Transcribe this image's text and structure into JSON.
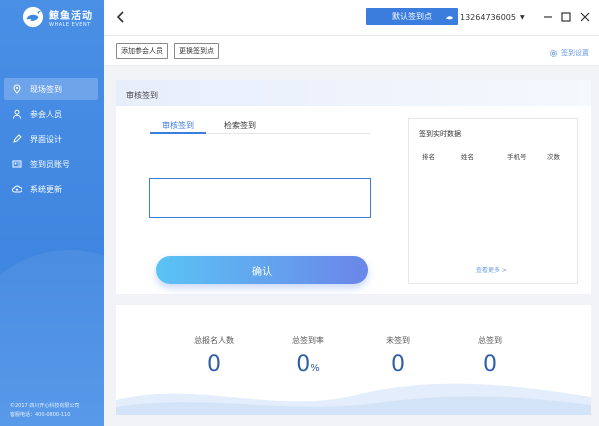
{
  "app": {
    "name": "鲸鱼活动",
    "subtitle": "WHALE EVENT"
  },
  "sidebar": {
    "items": [
      {
        "label": "现场签到",
        "icon": "location-pin-icon",
        "active": true
      },
      {
        "label": "参会人员",
        "icon": "user-icon",
        "active": false
      },
      {
        "label": "界面设计",
        "icon": "pen-icon",
        "active": false
      },
      {
        "label": "签到员账号",
        "icon": "id-card-icon",
        "active": false
      },
      {
        "label": "系统更新",
        "icon": "cloud-update-icon",
        "active": false
      }
    ],
    "footer_copyright": "©2017 四川开心科技有限公司",
    "footer_phone": "客服电话：400-0800-110"
  },
  "topbar": {
    "default_checkin_point": "默认签到点",
    "user_phone": "13264736005",
    "user_dropdown": "▼"
  },
  "toolbar": {
    "add_attendee": "添加参会人员",
    "change_checkin_point": "更换签到点",
    "checkin_settings": "签到设置"
  },
  "review": {
    "header": "审核签到",
    "tab_review": "审核签到",
    "tab_search": "检索签到",
    "input_value": "",
    "confirm": "确认"
  },
  "realtime": {
    "title": "签到实时数据",
    "columns": [
      "排名",
      "姓名",
      "手机号",
      "次数"
    ],
    "more": "查看更多 >"
  },
  "stats": [
    {
      "label": "总报名人数",
      "value": "0",
      "unit": ""
    },
    {
      "label": "总签到率",
      "value": "0",
      "unit": "%"
    },
    {
      "label": "未签到",
      "value": "0",
      "unit": ""
    },
    {
      "label": "总签到",
      "value": "0",
      "unit": ""
    }
  ],
  "colors": {
    "primary": "#3b7ddd",
    "sidebar": "#4a8fe6",
    "stat_value": "#2f5fa8"
  }
}
